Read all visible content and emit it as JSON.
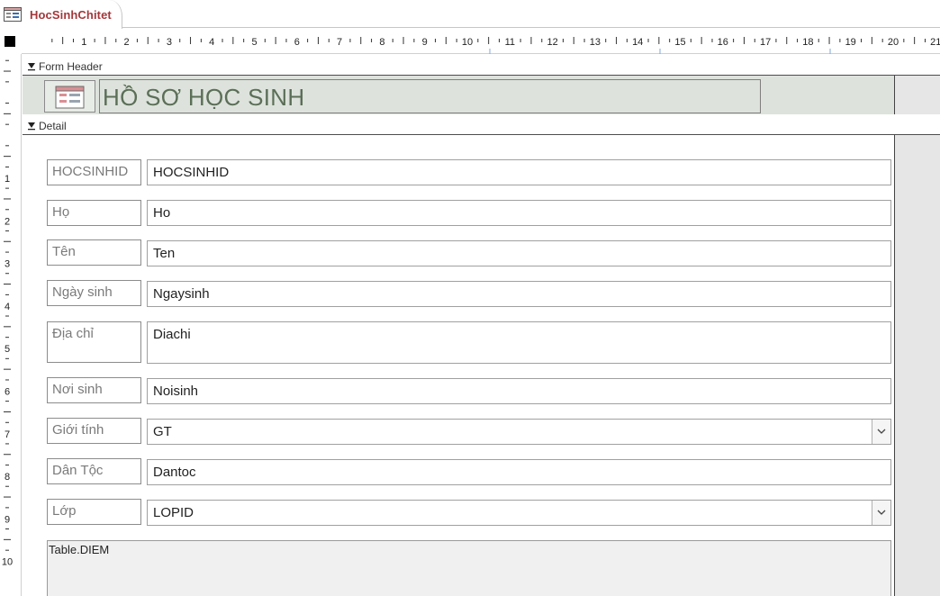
{
  "tab": {
    "title": "HocSinhChitet",
    "icon": "form-icon"
  },
  "ruler": {
    "horizontal_numbers": [
      "1",
      "2",
      "3",
      "4",
      "5",
      "6",
      "7",
      "8",
      "9",
      "10",
      "11",
      "12",
      "13",
      "14",
      "15",
      "16",
      "17",
      "18",
      "19",
      "20",
      "21"
    ],
    "vertical_numbers": [
      "1",
      "2",
      "3",
      "4",
      "5",
      "6",
      "7",
      "8",
      "9",
      "10"
    ]
  },
  "sections": {
    "form_header": "Form Header",
    "detail": "Detail"
  },
  "header": {
    "title": "HỒ SƠ HỌC SINH",
    "logo_icon": "form-logo-icon"
  },
  "fields": [
    {
      "label": "HOCSINHID",
      "value": "HOCSINHID",
      "type": "text"
    },
    {
      "label": "Họ",
      "value": "Ho",
      "type": "text"
    },
    {
      "label": "Tên",
      "value": "Ten",
      "type": "text"
    },
    {
      "label": "Ngày sinh",
      "value": "Ngaysinh",
      "type": "text"
    },
    {
      "label": "Địa chỉ",
      "value": "Diachi",
      "type": "textarea"
    },
    {
      "label": "Nơi sinh",
      "value": "Noisinh",
      "type": "text"
    },
    {
      "label": "Giới tính",
      "value": "GT",
      "type": "combo"
    },
    {
      "label": "Dân Tộc",
      "value": "Dantoc",
      "type": "text"
    },
    {
      "label": "Lớp",
      "value": "LOPID",
      "type": "combo"
    }
  ],
  "subform": {
    "source": "Table.DIEM"
  },
  "colors": {
    "tab_title": "#a4373a",
    "header_band": "#dde3dc",
    "title_text": "#5b6f57"
  }
}
